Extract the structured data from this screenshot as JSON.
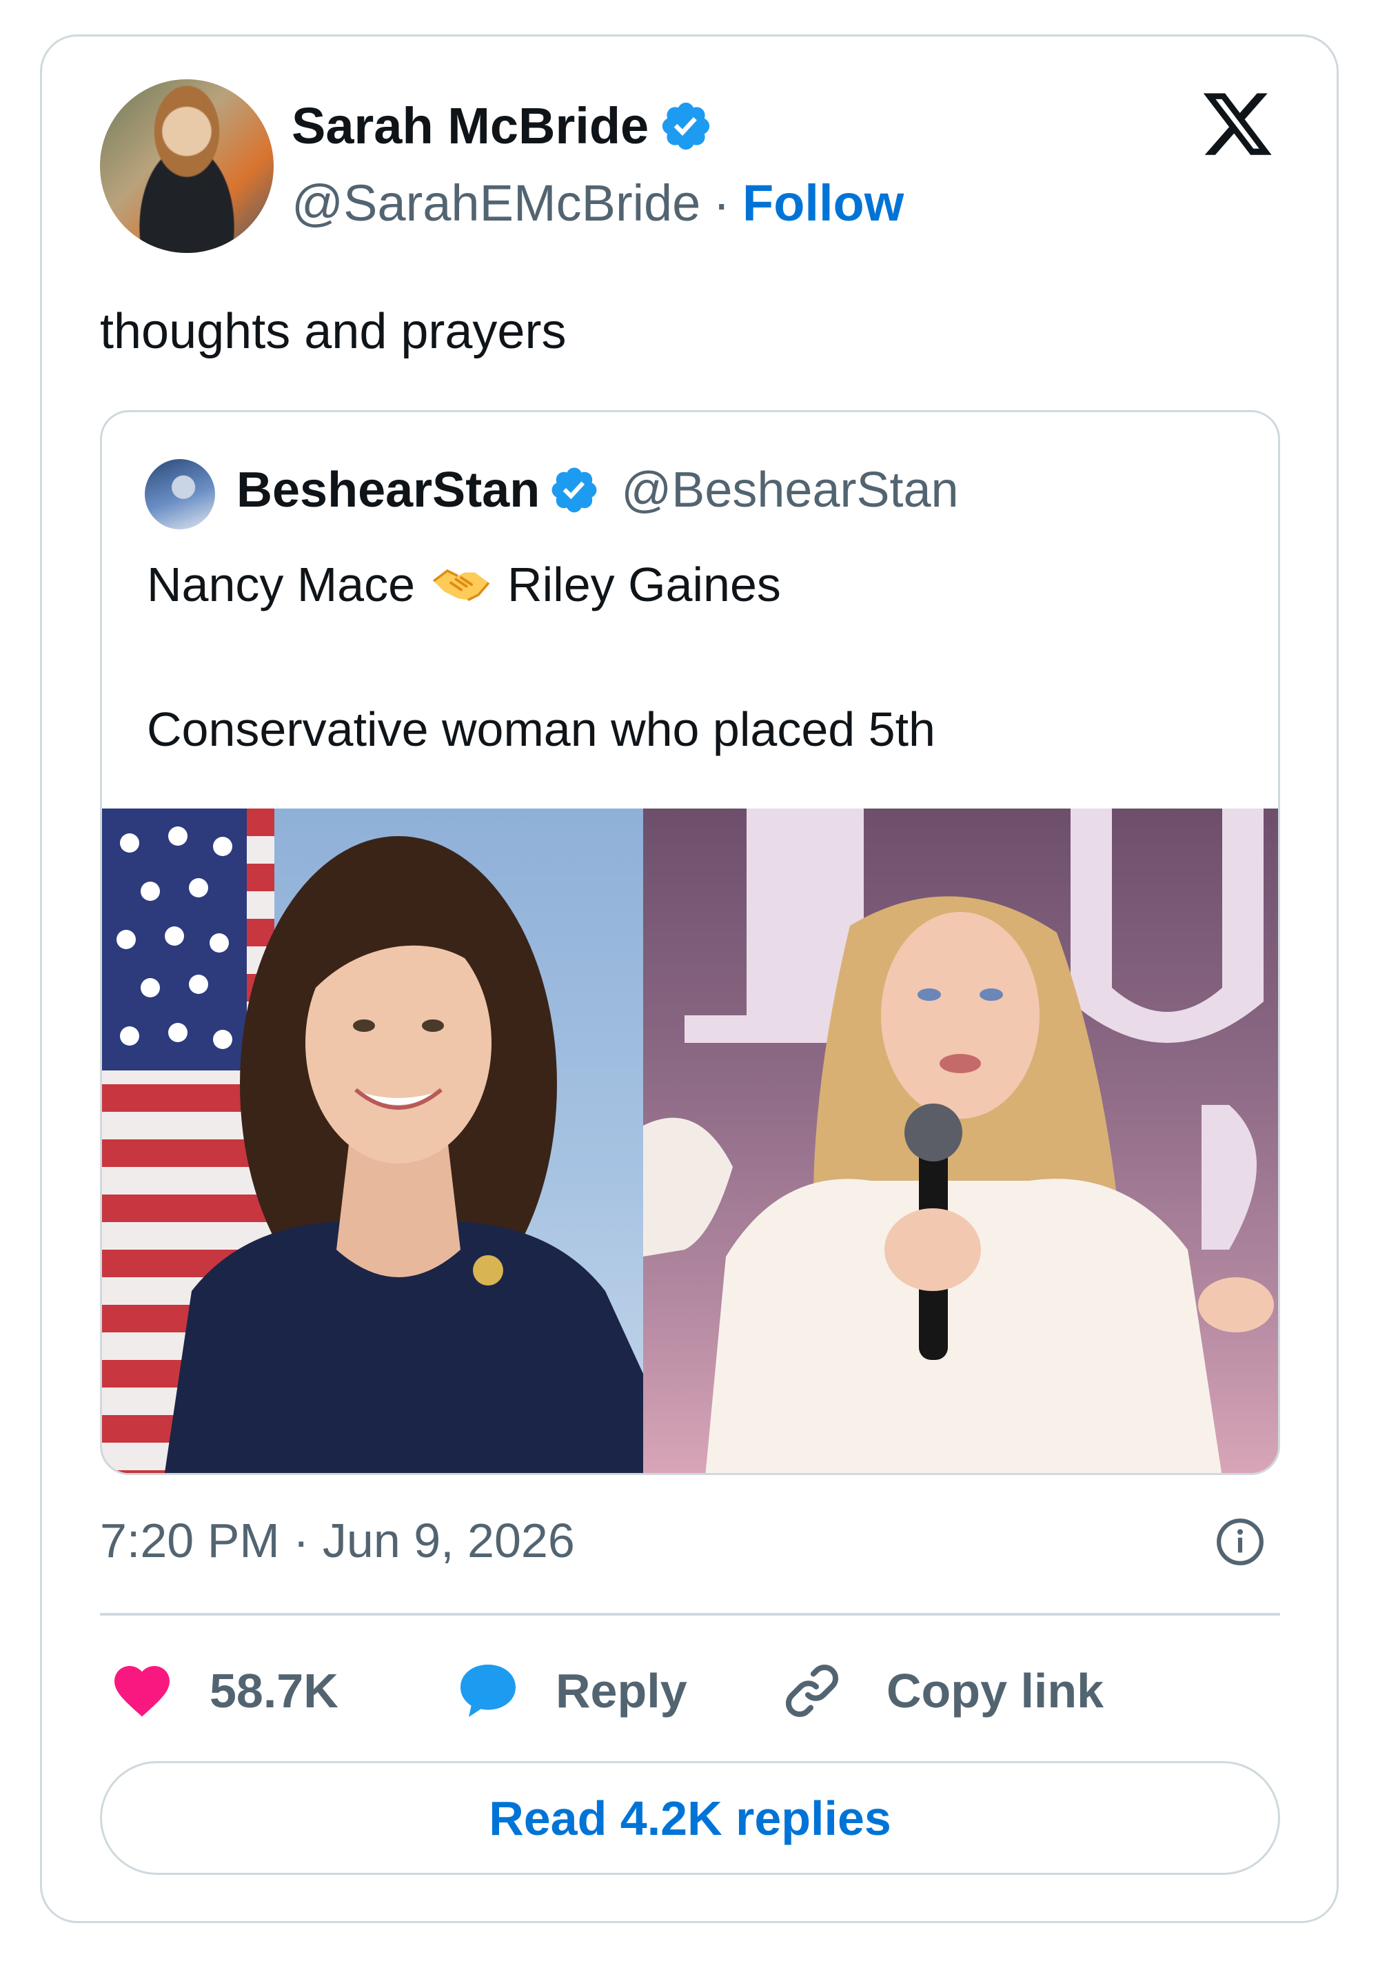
{
  "tweet": {
    "author_name": "Sarah McBride",
    "author_handle": "@SarahEMcBride",
    "separator": "·",
    "follow_label": "Follow",
    "text": "thoughts and prayers",
    "timestamp": "7:20 PM · Jun 9, 2026"
  },
  "quoted": {
    "author_name": "BeshearStan",
    "author_handle": "@BeshearStan",
    "line1_left": "Nancy Mace",
    "line1_emoji": "handshake-emoji",
    "line1_right": "Riley Gaines",
    "line2": "Conservative woman who placed 5th"
  },
  "actions": {
    "likes": "58.7K",
    "reply_label": "Reply",
    "copy_label": "Copy link"
  },
  "read_replies_label": "Read 4.2K replies",
  "icons": [
    "x-logo-icon",
    "verified-badge-icon",
    "info-icon",
    "heart-icon",
    "reply-bubble-icon",
    "link-icon"
  ],
  "colors": {
    "accent_blue": "#0074d6",
    "verified_blue": "#1d9bf0",
    "like_pink": "#f91880",
    "secondary_text": "#536471",
    "border": "#cfd9de"
  }
}
